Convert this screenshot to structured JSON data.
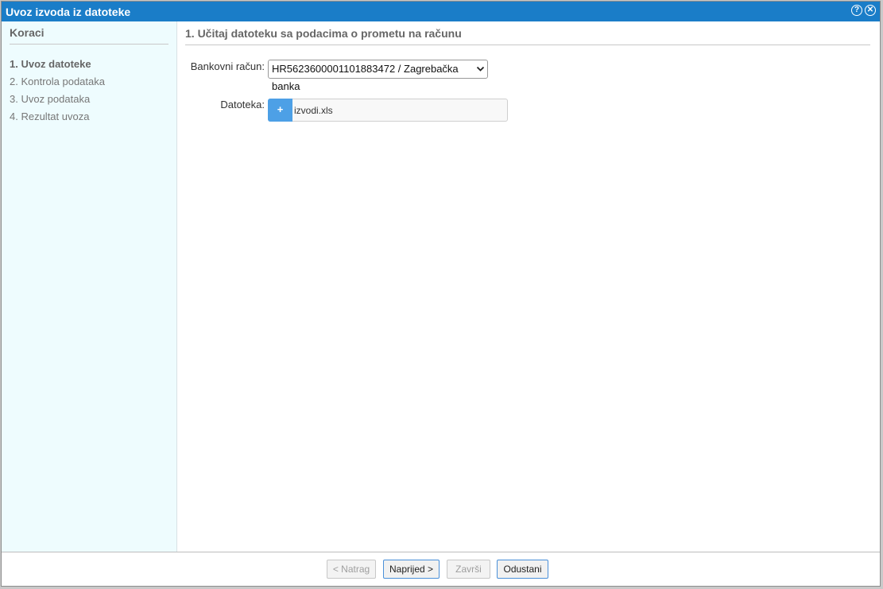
{
  "window": {
    "title": "Uvoz izvoda iz datoteke",
    "help_icon": "?",
    "close_icon": "✕"
  },
  "sidebar": {
    "heading": "Koraci",
    "steps": [
      {
        "label": "1. Uvoz datoteke",
        "active": true
      },
      {
        "label": "2. Kontrola podataka",
        "active": false
      },
      {
        "label": "3. Uvoz podataka",
        "active": false
      },
      {
        "label": "4. Rezultat uvoza",
        "active": false
      }
    ]
  },
  "main": {
    "heading": "1. Učitaj datoteku sa podacima o prometu na računu",
    "bank_account": {
      "label": "Bankovni račun:",
      "selected": "HR5623600001101883472 / Zagrebačka banka"
    },
    "file": {
      "label": "Datoteka:",
      "button": "+",
      "filename": "izvodi.xls"
    }
  },
  "footer": {
    "back": "< Natrag",
    "next": "Naprijed >",
    "finish": "Završi",
    "cancel": "Odustani"
  },
  "colors": {
    "titlebar": "#1a7dc8",
    "sidebar_bg": "#eefcfe",
    "file_button": "#4da0e6"
  }
}
